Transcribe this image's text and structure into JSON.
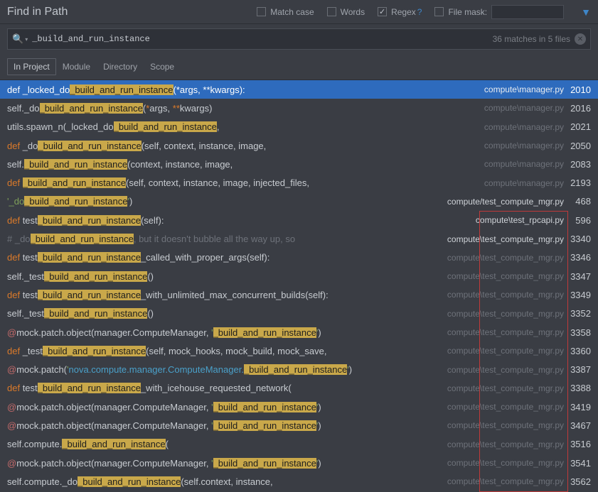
{
  "title": "Find in Path",
  "options": {
    "match_case": "Match case",
    "words": "Words",
    "regex": "Regex",
    "file_mask": "File mask:"
  },
  "search": {
    "query": "_build_and_run_instance",
    "summary": "36 matches in 5 files"
  },
  "scopes": {
    "in_project": "In Project",
    "module": "Module",
    "directory": "Directory",
    "scope": "Scope"
  },
  "rows": [
    {
      "pre": "def _locked_do",
      "hl": "_build_and_run_instance",
      "post": "(*args, **kwargs):",
      "file": "compute\\manager.py",
      "line": "2010",
      "style": "sel"
    },
    {
      "pre": "self._do",
      "hl": "_build_and_run_instance",
      "post": "(*args, **kwargs)",
      "file": "compute\\manager.py",
      "line": "2016",
      "style": "args"
    },
    {
      "pre": "utils.spawn_n(_locked_do",
      "hl": "_build_and_run_instance",
      "post": ",",
      "file": "compute\\manager.py",
      "line": "2021"
    },
    {
      "pre": "def _do",
      "hl": "_build_and_run_instance",
      "post": "(self, context, instance, image,",
      "file": "compute\\manager.py",
      "line": "2050",
      "style": "def"
    },
    {
      "pre": "self.",
      "hl": "_build_and_run_instance",
      "post": "(context, instance, image,",
      "file": "compute\\manager.py",
      "line": "2083"
    },
    {
      "pre": "def ",
      "hl": "_build_and_run_instance",
      "post": "(self, context, instance, image, injected_files,",
      "file": "compute\\manager.py",
      "line": "2193",
      "style": "def"
    },
    {
      "pre": "'_do",
      "hl": "_build_and_run_instance",
      "post": "')",
      "file": "compute/test_compute_mgr.py",
      "line": "468",
      "style": "str",
      "contrast": true
    },
    {
      "pre": "def test",
      "hl": "_build_and_run_instance",
      "post": "(self):",
      "file": "compute\\test_rpcapi.py",
      "line": "596",
      "style": "def",
      "contrast": true
    },
    {
      "pre": "# _do",
      "hl": "_build_and_run_instance",
      "post": ", but it doesn't bubble all the way up, so",
      "file": "compute\\test_compute_mgr.py",
      "line": "3340",
      "style": "comment",
      "contrast": true
    },
    {
      "pre": "def test",
      "hl": "_build_and_run_instance",
      "post": "_called_with_proper_args(self):",
      "file": "compute\\test_compute_mgr.py",
      "line": "3346",
      "style": "def"
    },
    {
      "pre": "self._test",
      "hl": "_build_and_run_instance",
      "post": "()",
      "file": "compute\\test_compute_mgr.py",
      "line": "3347"
    },
    {
      "pre": "def test",
      "hl": "_build_and_run_instance",
      "post": "_with_unlimited_max_concurrent_builds(self):",
      "file": "compute\\test_compute_mgr.py",
      "line": "3349",
      "style": "def"
    },
    {
      "pre": "self._test",
      "hl": "_build_and_run_instance",
      "post": "()",
      "file": "compute\\test_compute_mgr.py",
      "line": "3352"
    },
    {
      "pre": "@mock.patch.object(manager.ComputeManager, '",
      "hl": "_build_and_run_instance",
      "post": "')",
      "file": "compute\\test_compute_mgr.py",
      "line": "3358",
      "style": "deco"
    },
    {
      "pre": "def _test",
      "hl": "_build_and_run_instance",
      "post": "(self, mock_hooks, mock_build, mock_save,",
      "file": "compute\\test_compute_mgr.py",
      "line": "3360",
      "style": "def"
    },
    {
      "pre": "@mock.patch('nova.compute.manager.ComputeManager.",
      "hl": "_build_and_run_instance",
      "post": "')",
      "file": "compute\\test_compute_mgr.py",
      "line": "3387",
      "style": "deco2"
    },
    {
      "pre": "def test",
      "hl": "_build_and_run_instance",
      "post": "_with_icehouse_requested_network(",
      "file": "compute\\test_compute_mgr.py",
      "line": "3388",
      "style": "def"
    },
    {
      "pre": "@mock.patch.object(manager.ComputeManager, '",
      "hl": "_build_and_run_instance",
      "post": "')",
      "file": "compute\\test_compute_mgr.py",
      "line": "3419",
      "style": "deco"
    },
    {
      "pre": "@mock.patch.object(manager.ComputeManager, '",
      "hl": "_build_and_run_instance",
      "post": "')",
      "file": "compute\\test_compute_mgr.py",
      "line": "3467",
      "style": "deco"
    },
    {
      "pre": "self.compute.",
      "hl": "_build_and_run_instance",
      "post": "(",
      "file": "compute\\test_compute_mgr.py",
      "line": "3516"
    },
    {
      "pre": "@mock.patch.object(manager.ComputeManager, '",
      "hl": "_build_and_run_instance",
      "post": "')",
      "file": "compute\\test_compute_mgr.py",
      "line": "3541",
      "style": "deco"
    },
    {
      "pre": "self.compute._do",
      "hl": "_build_and_run_instance",
      "post": "(self.context, instance,",
      "file": "compute\\test_compute_mgr.py",
      "line": "3562"
    }
  ]
}
